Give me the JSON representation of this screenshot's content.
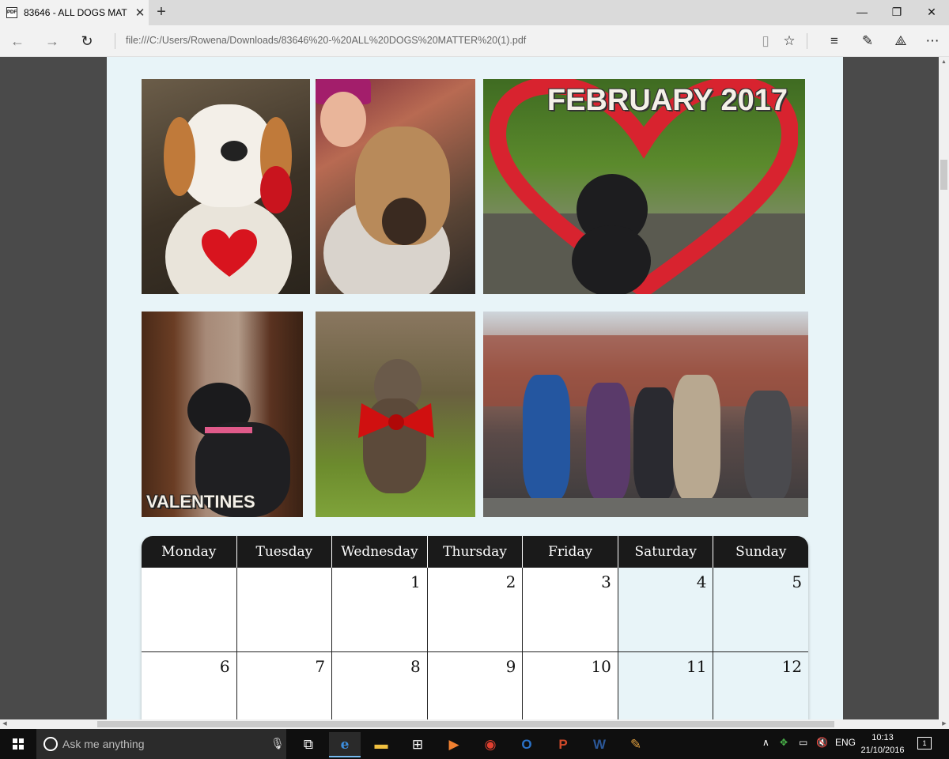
{
  "browser": {
    "tab_title": "83646 - ALL DOGS MAT",
    "tab_favicon": "PDF",
    "url": "file:///C:/Users/Rowena/Downloads/83646%20-%20ALL%20DOGS%20MATTER%20(1).pdf",
    "icons": {
      "back": "←",
      "forward": "→",
      "refresh": "↻",
      "reading_view": "▯",
      "favorite": "☆",
      "hub": "≡",
      "notes": "✎",
      "share": "⟁",
      "more": "⋯",
      "minimize": "—",
      "restore": "❐",
      "close": "✕",
      "new_tab": "+",
      "tab_close": "✕"
    }
  },
  "pdf": {
    "photo_labels": {
      "header": "FEBRUARY 2017",
      "corner": "VALENTINES"
    },
    "calendar": {
      "days": [
        "Monday",
        "Tuesday",
        "Wednesday",
        "Thursday",
        "Friday",
        "Saturday",
        "Sunday"
      ],
      "weeks": [
        [
          "",
          "",
          "1",
          "2",
          "3",
          "4",
          "5"
        ],
        [
          "6",
          "7",
          "8",
          "9",
          "10",
          "11",
          "12"
        ]
      ]
    }
  },
  "taskbar": {
    "search_placeholder": "Ask me anything",
    "language": "ENG",
    "time": "10:13",
    "date": "21/10/2016",
    "notification_count": "1",
    "accent_color": "#76b9ed"
  }
}
